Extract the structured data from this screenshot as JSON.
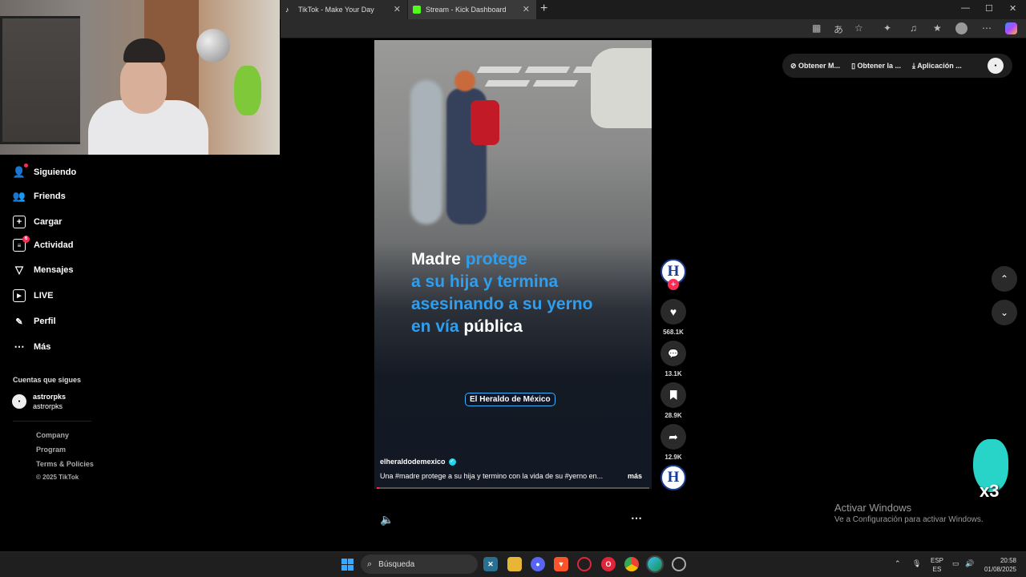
{
  "browser": {
    "tabs": [
      {
        "label": "TikTok - Make Your Day"
      },
      {
        "label": "Stream - Kick Dashboard"
      }
    ],
    "new_tab": "+",
    "window_controls": [
      "—",
      "☐",
      "✕"
    ]
  },
  "sidebar": {
    "items": [
      {
        "label": "Siguiendo",
        "icon": "user-icon"
      },
      {
        "label": "Friends",
        "icon": "friends-icon"
      },
      {
        "label": "Cargar",
        "icon": "upload-icon"
      },
      {
        "label": "Actividad",
        "icon": "activity-icon",
        "badge": "6"
      },
      {
        "label": "Mensajes",
        "icon": "send-icon"
      },
      {
        "label": "LIVE",
        "icon": "live-icon"
      },
      {
        "label": "Perfil",
        "icon": "profile-icon"
      },
      {
        "label": "Más",
        "icon": "more-icon"
      }
    ],
    "following_title": "Cuentas que sigues",
    "following": [
      {
        "name": "astrorpks",
        "handle": "astrorpks"
      }
    ],
    "footer": [
      "Company",
      "Program",
      "Terms & Policies",
      "© 2025 TikTok"
    ]
  },
  "video": {
    "headline": {
      "line1_white": "Madre ",
      "line1_blue": "protege",
      "line2": "a su hija y termina",
      "line3": "asesinando a su yerno",
      "line4_blue": "en vía ",
      "line4_white": "pública"
    },
    "brand_label": "El Heraldo de México",
    "author": "elheraldodemexico",
    "caption": "Una #madre  protege a su hija y termino con la vida de su #yerno  en...",
    "more_label": "más",
    "progress": 0.01
  },
  "actions": {
    "avatar_letter": "H",
    "likes": "568.1K",
    "comments": "13.1K",
    "saves": "28.9K",
    "shares": "12.9K"
  },
  "top_right": {
    "buttons": [
      "Obtener M...",
      "Obtener la ...",
      "Aplicación ..."
    ]
  },
  "overlay": {
    "multiplier": "x3",
    "activate_title": "Activar Windows",
    "activate_sub": "Ve a Configuración para activar Windows."
  },
  "taskbar": {
    "search_placeholder": "Búsqueda",
    "lang_top": "ESP",
    "lang_bottom": "ES",
    "time": "20:58",
    "date": "01/08/2025"
  },
  "colors": {
    "accent": "#fe2c55",
    "headline_blue": "#2e9ff0",
    "teal": "#20d5ec"
  }
}
